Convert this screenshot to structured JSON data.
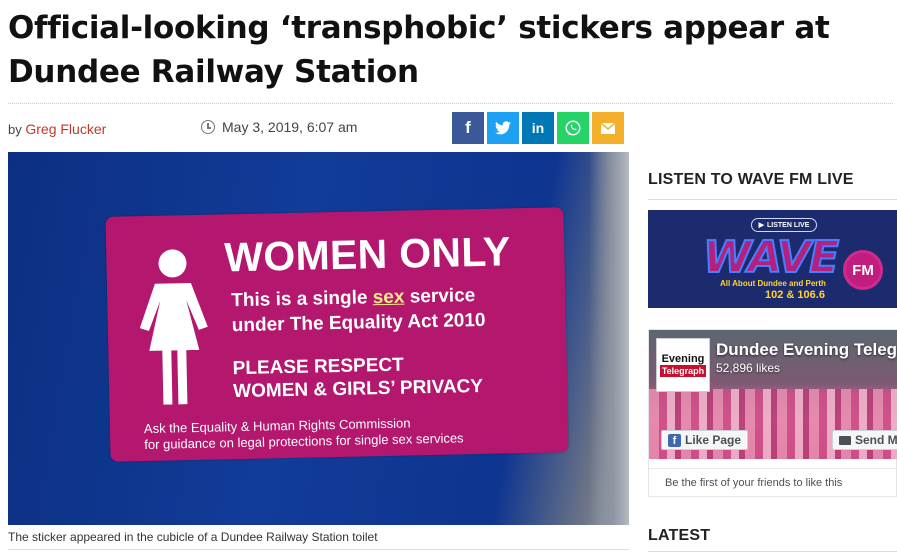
{
  "article": {
    "headline": "Official-looking ‘transphobic’ stickers appear at Dundee Railway Station",
    "by_prefix": "by",
    "author": "Greg Flucker",
    "date": "May 3, 2019, 6:07 am",
    "caption": "The sticker appeared in the cubicle of a Dundee Railway Station toilet"
  },
  "share": {
    "facebook_glyph": "f",
    "twitter_glyph": "t",
    "linkedin_glyph": "in",
    "whatsapp_glyph": "✆",
    "email_glyph": "✉",
    "colors": {
      "facebook": "#3b5998",
      "twitter": "#1da1f2",
      "linkedin": "#0077b5",
      "whatsapp": "#25d366",
      "email": "#f4b02a"
    }
  },
  "sticker": {
    "title": "WOMEN ONLY",
    "line1_pre": "This is a single ",
    "line1_hl": "sex",
    "line1_post": " service",
    "line2": "under The Equality Act 2010",
    "line3": "PLEASE RESPECT",
    "line4": "WOMEN & GIRLS’ PRIVACY",
    "small1": "Ask the Equality & Human Rights Commission",
    "small2": "for guidance on legal protections for single sex services",
    "color": "#b3176e"
  },
  "sidebar": {
    "heading_radio": "LISTEN TO WAVE FM LIVE",
    "heading_latest": "LATEST",
    "wave": {
      "live_label": "LISTEN LIVE",
      "logo": "WAVE",
      "fm": "FM",
      "tagline": "All About Dundee and Perth",
      "frequencies": "102 & 106.6"
    },
    "facebook": {
      "logo_line1": "Evening",
      "logo_line2": "Telegraph",
      "page_name": "Dundee Evening Teleg",
      "likes": "52,896 likes",
      "like_button": "Like Page",
      "send_button": "Send Me",
      "friends_text": "Be the first of your friends to like this"
    }
  }
}
